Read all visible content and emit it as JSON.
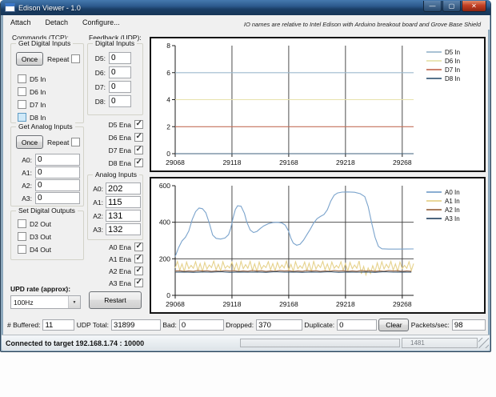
{
  "window": {
    "title": "Edison Viewer - 1.0"
  },
  "icons": {
    "minimize": "—",
    "maximize": "▢",
    "close": "✕",
    "dropdown_arrow": "▼"
  },
  "menu": {
    "attach": "Attach",
    "detach": "Detach",
    "configure": "Configure..."
  },
  "note": "IO names are relative to Intel Edison with Arduino breakout board and Grove Base Shield",
  "commands": {
    "title": "Commands (TCP):",
    "get_digital": {
      "title": "Get Digital Inputs",
      "once": "Once",
      "repeat": "Repeat",
      "checks": [
        {
          "label": "D5 In",
          "checked": false
        },
        {
          "label": "D6 In",
          "checked": false
        },
        {
          "label": "D7 In",
          "checked": false
        },
        {
          "label": "D8 In",
          "checked": false
        }
      ]
    },
    "get_analog": {
      "title": "Get Analog Inputs",
      "once": "Once",
      "repeat": "Repeat",
      "fields": [
        {
          "label": "A0:",
          "value": "0"
        },
        {
          "label": "A1:",
          "value": "0"
        },
        {
          "label": "A2:",
          "value": "0"
        },
        {
          "label": "A3:",
          "value": "0"
        }
      ]
    },
    "set_outputs": {
      "title": "Set Digital Outputs",
      "checks": [
        {
          "label": "D2 Out",
          "checked": false
        },
        {
          "label": "D3 Out",
          "checked": false
        },
        {
          "label": "D4 Out",
          "checked": false
        }
      ]
    },
    "upd_rate": {
      "label": "UPD rate (approx):",
      "value": "100Hz"
    }
  },
  "feedback": {
    "title": "Feedback (UDP):",
    "digital": {
      "title": "Digital Inputs",
      "fields": [
        {
          "label": "D5:",
          "value": "0"
        },
        {
          "label": "D6:",
          "value": "0"
        },
        {
          "label": "D7:",
          "value": "0"
        },
        {
          "label": "D8:",
          "value": "0"
        }
      ]
    },
    "digital_ena": [
      {
        "label": "D5 Ena",
        "checked": true
      },
      {
        "label": "D6 Ena",
        "checked": true
      },
      {
        "label": "D7 Ena",
        "checked": true
      },
      {
        "label": "D8 Ena",
        "checked": true
      }
    ],
    "analog": {
      "title": "Analog Inputs",
      "fields": [
        {
          "label": "A0:",
          "value": "202"
        },
        {
          "label": "A1:",
          "value": "115"
        },
        {
          "label": "A2:",
          "value": "131"
        },
        {
          "label": "A3:",
          "value": "132"
        }
      ]
    },
    "analog_ena": [
      {
        "label": "A0 Ena",
        "checked": true
      },
      {
        "label": "A1 Ena",
        "checked": true
      },
      {
        "label": "A2 Ena",
        "checked": true
      },
      {
        "label": "A3 Ena",
        "checked": true
      }
    ],
    "restart": "Restart"
  },
  "stats": {
    "buffered": {
      "label": "# Buffered:",
      "value": "11"
    },
    "udp_total": {
      "label": "UDP Total:",
      "value": "31899"
    },
    "bad": {
      "label": "Bad:",
      "value": "0"
    },
    "dropped": {
      "label": "Dropped:",
      "value": "370"
    },
    "duplicate": {
      "label": "Duplicate:",
      "value": "0"
    },
    "clear_label": "Clear",
    "packets": {
      "label": "Packets/sec:",
      "value": "98"
    }
  },
  "statusbar": {
    "text": "Connected to target 192.168.1.74 : 10000",
    "counter": "1481"
  },
  "chart_data": [
    {
      "type": "line",
      "title": "",
      "xlabel": "",
      "ylabel": "",
      "xlim": [
        29068,
        29278
      ],
      "ylim": [
        0,
        8
      ],
      "x_ticks": [
        29068,
        29118,
        29168,
        29218,
        29268
      ],
      "y_ticks": [
        0,
        2,
        4,
        6,
        8
      ],
      "grid": {
        "vertical": true,
        "horizontal": false
      },
      "legend_position": "top-right",
      "series": [
        {
          "name": "D5 In",
          "color": "#9dbace",
          "points": [
            [
              29068,
              6
            ],
            [
              29278,
              6
            ]
          ]
        },
        {
          "name": "D6 In",
          "color": "#e7e2ad",
          "points": [
            [
              29068,
              4
            ],
            [
              29278,
              4
            ]
          ]
        },
        {
          "name": "D7 In",
          "color": "#c4705a",
          "points": [
            [
              29068,
              2
            ],
            [
              29278,
              2
            ]
          ]
        },
        {
          "name": "D8 In",
          "color": "#3f617c",
          "points": [
            [
              29068,
              0
            ],
            [
              29278,
              0
            ]
          ]
        }
      ]
    },
    {
      "type": "line",
      "title": "",
      "xlabel": "",
      "ylabel": "",
      "xlim": [
        29068,
        29278
      ],
      "ylim": [
        0,
        600
      ],
      "x_ticks": [
        29068,
        29118,
        29168,
        29218,
        29268
      ],
      "y_ticks": [
        0,
        200,
        400,
        600
      ],
      "grid": {
        "vertical": true,
        "horizontal": true
      },
      "legend_position": "top-right",
      "series": [
        {
          "name": "A0 In",
          "color": "#7aa3cc",
          "points": [
            [
              29068,
              212
            ],
            [
              29071,
              262
            ],
            [
              29074,
              298
            ],
            [
              29077,
              318
            ],
            [
              29080,
              352
            ],
            [
              29083,
              415
            ],
            [
              29086,
              458
            ],
            [
              29089,
              478
            ],
            [
              29092,
              474
            ],
            [
              29095,
              452
            ],
            [
              29098,
              396
            ],
            [
              29101,
              330
            ],
            [
              29104,
              312
            ],
            [
              29108,
              308
            ],
            [
              29112,
              314
            ],
            [
              29115,
              332
            ],
            [
              29117,
              368
            ],
            [
              29119,
              425
            ],
            [
              29121,
              470
            ],
            [
              29123,
              490
            ],
            [
              29126,
              488
            ],
            [
              29129,
              448
            ],
            [
              29131,
              402
            ],
            [
              29134,
              358
            ],
            [
              29137,
              344
            ],
            [
              29140,
              350
            ],
            [
              29143,
              366
            ],
            [
              29146,
              380
            ],
            [
              29150,
              392
            ],
            [
              29154,
              398
            ],
            [
              29158,
              400
            ],
            [
              29162,
              396
            ],
            [
              29165,
              384
            ],
            [
              29168,
              350
            ],
            [
              29170,
              312
            ],
            [
              29172,
              286
            ],
            [
              29175,
              274
            ],
            [
              29178,
              280
            ],
            [
              29181,
              302
            ],
            [
              29184,
              332
            ],
            [
              29187,
              362
            ],
            [
              29190,
              396
            ],
            [
              29193,
              420
            ],
            [
              29196,
              432
            ],
            [
              29199,
              442
            ],
            [
              29202,
              468
            ],
            [
              29205,
              515
            ],
            [
              29208,
              548
            ],
            [
              29211,
              560
            ],
            [
              29215,
              565
            ],
            [
              29220,
              566
            ],
            [
              29226,
              564
            ],
            [
              29231,
              556
            ],
            [
              29235,
              540
            ],
            [
              29238,
              486
            ],
            [
              29241,
              398
            ],
            [
              29244,
              318
            ],
            [
              29247,
              268
            ],
            [
              29250,
              255
            ],
            [
              29256,
              253
            ],
            [
              29264,
              253
            ],
            [
              29278,
              254
            ]
          ]
        },
        {
          "name": "A1 In",
          "color": "#e6d28c",
          "x0": 29068,
          "dx": 2,
          "y": [
            150,
            186,
            138,
            172,
            132,
            182,
            146,
            164,
            148,
            184,
            136,
            174,
            130,
            180,
            144,
            166,
            152,
            188,
            140,
            170,
            134,
            184,
            148,
            162,
            150,
            182,
            138,
            176,
            132,
            186,
            146,
            168,
            148,
            186,
            136,
            172,
            130,
            182,
            144,
            164,
            152,
            184,
            140,
            174,
            134,
            180,
            148,
            166,
            150,
            188,
            138,
            170,
            132,
            184,
            146,
            162,
            148,
            182,
            136,
            176,
            130,
            186,
            144,
            168,
            152,
            186,
            140,
            172,
            134,
            182,
            148,
            164,
            150,
            184,
            138,
            174,
            132,
            180,
            146,
            166,
            148,
            188,
            118,
            158,
            112,
            150,
            120,
            162,
            130,
            178,
            136,
            184,
            144,
            170,
            150,
            186,
            138,
            172,
            132,
            182,
            146,
            164,
            148,
            184,
            136,
            174
          ]
        },
        {
          "name": "A2 In",
          "color": "#9e6b4a",
          "x0": 29068,
          "dx": 4,
          "y": [
            133,
            135,
            131,
            134,
            132,
            136,
            133,
            135,
            131,
            134,
            132,
            136,
            133,
            135,
            131,
            134,
            132,
            136,
            133,
            135,
            131,
            134,
            132,
            136,
            133,
            135,
            131,
            134,
            132,
            136,
            133,
            135,
            131,
            134,
            132,
            136,
            133,
            135,
            131,
            134,
            132,
            136,
            133,
            135,
            131,
            134,
            132,
            136,
            133,
            135,
            131,
            134,
            132
          ]
        },
        {
          "name": "A3 In",
          "color": "#32506b",
          "x0": 29068,
          "dx": 8,
          "y": [
            127,
            128,
            126,
            128,
            127,
            129,
            126,
            128,
            127,
            128,
            126,
            129,
            127,
            128,
            126,
            128,
            127,
            129,
            126,
            128,
            127,
            128,
            126,
            129,
            127,
            128,
            127
          ]
        }
      ]
    }
  ]
}
